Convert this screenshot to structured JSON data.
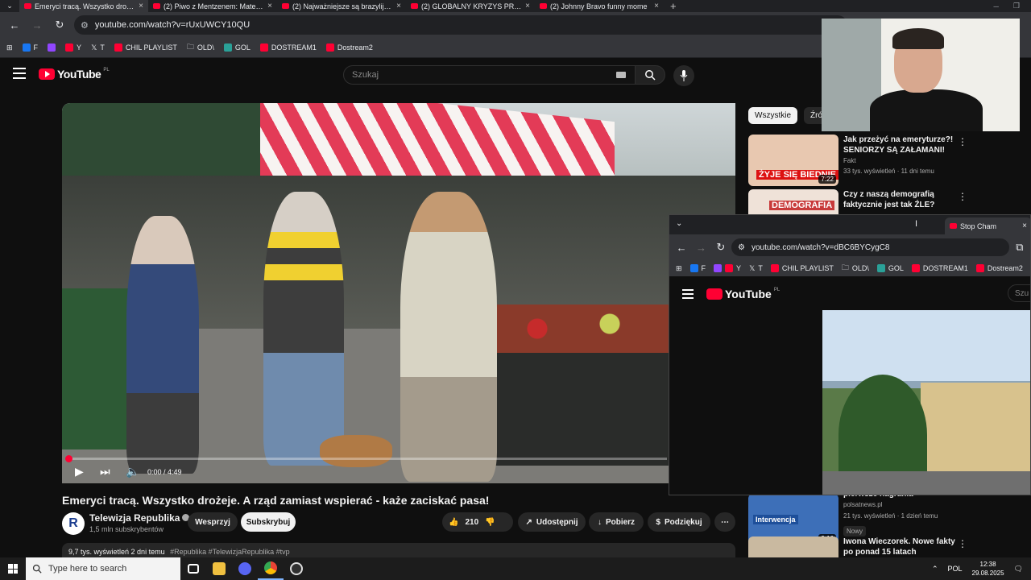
{
  "browser": {
    "tabs": [
      {
        "title": "Emeryci tracą. Wszystko drożeje",
        "active": true
      },
      {
        "title": "(2) Piwo z Mentzenem: Mateusz",
        "active": false
      },
      {
        "title": "(2) Najważniejsze są brazylijskie",
        "active": false
      },
      {
        "title": "(2) GLOBALNY KRYZYS PRZEZ",
        "active": false
      },
      {
        "title": "(2) Johnny Bravo funny mome",
        "active": false
      }
    ],
    "url": "youtube.com/watch?v=rUxUWCY10QU",
    "bookmarks": [
      "F",
      "Y",
      "T",
      "CHIL PLAYLIST",
      "OLD\\",
      "GOL",
      "DOSTREAM1",
      "Dostream2"
    ]
  },
  "youtube": {
    "logo_text": "YouTube",
    "country_code": "PL",
    "search_placeholder": "Szukaj"
  },
  "player": {
    "time": "0:00 / 4:49",
    "progress": 0.0
  },
  "video": {
    "title": "Emeryci tracą. Wszystko drożeje. A rząd zamiast wspierać - każe zaciskać pasa!",
    "channel": "Telewizja Republika",
    "subscribers": "1,5 mln subskrybentów",
    "support_label": "Wesprzyj",
    "subscribe_label": "Subskrybuj",
    "likes": "210",
    "share_label": "Udostępnij",
    "download_label": "Pobierz",
    "thanks_label": "Podziękuj",
    "views": "9,7 tys. wyświetleń",
    "date": "2 dni temu",
    "tags": "#Republika #TelewizjaRepublika #tvp"
  },
  "sidebar": {
    "chips": [
      "Wszystkie",
      "Źród"
    ],
    "recs": [
      {
        "title": "Jak przeżyć na emeryturze?! SENIORZY SĄ ZAŁAMANI!",
        "channel": "Fakt",
        "meta": "33 tys. wyświetleń · 11 dni temu",
        "duration": "7:22",
        "thumb_text": "ŻYJE SIĘ BIEDNIE",
        "thumb_color": "#e8c8b0"
      },
      {
        "title": "Czy z naszą demografią faktycznie jest tak ŹLE?",
        "channel": "",
        "meta": "",
        "duration": "",
        "thumb_text": "DEMOGRAFIA",
        "thumb_color": "#c83a3a"
      },
      {
        "title": "pierwsze nagrania",
        "channel": "polsatnews.pl",
        "meta": "21 tys. wyświetleń · 1 dzień temu",
        "duration": "9:16",
        "thumb_text": "Interwencja",
        "thumb_color": "#1e4f9a",
        "badge": "Nowy"
      },
      {
        "title": "Iwona Wieczorek. Nowe fakty po ponad 15 latach poszukiwań",
        "channel": "",
        "meta": "",
        "duration": "",
        "thumb_text": "",
        "thumb_color": "#c9b9a0"
      }
    ]
  },
  "overlay_window": {
    "tab_title": "Stop Cham",
    "url": "youtube.com/watch?v=dBC6BYCygC8",
    "bookmarks": [
      "F",
      "Y",
      "T",
      "CHIL PLAYLIST",
      "OLD\\",
      "GOL",
      "DOSTREAM1",
      "Dostream2"
    ],
    "logo_text": "YouTube",
    "country_code": "PL",
    "search_placeholder": "Szu"
  },
  "taskbar": {
    "search_placeholder": "Type here to search",
    "language": "POL",
    "time": "12:38",
    "date": "29.08.2025"
  },
  "colors": {
    "youtube_red": "#ff0033",
    "page_bg": "#0f0f0f",
    "chrome_bg": "#35363a"
  }
}
